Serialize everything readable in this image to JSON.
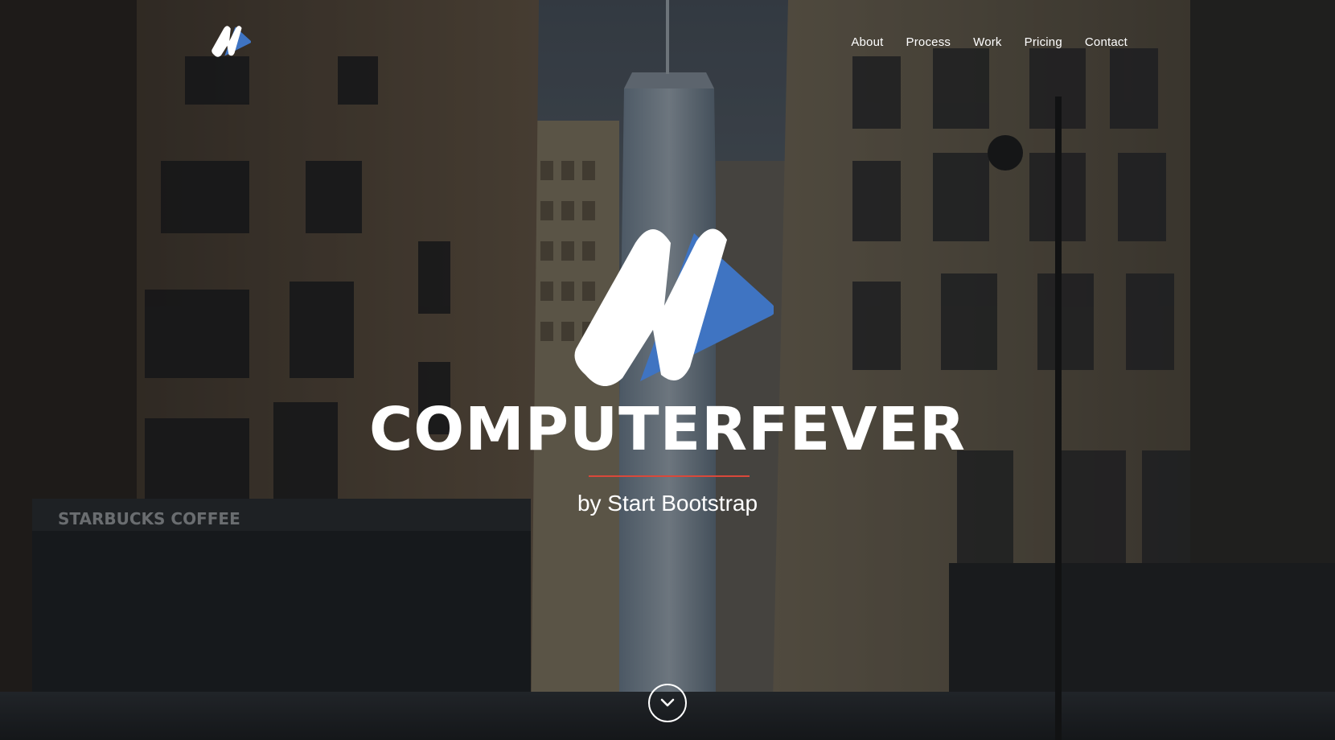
{
  "nav": {
    "logo_icon": "computerfever-m-logo-icon",
    "items": [
      {
        "label": "About"
      },
      {
        "label": "Process"
      },
      {
        "label": "Work"
      },
      {
        "label": "Pricing"
      },
      {
        "label": "Contact"
      }
    ]
  },
  "hero": {
    "logo_icon": "computerfever-m-logo-icon",
    "title": "COMPUTERFEVER",
    "subtitle": "by Start Bootstrap",
    "scroll_icon": "chevron-down-circle-icon",
    "background": "city-street-photo"
  },
  "colors": {
    "accent_blue": "#3f74c2",
    "divider_red": "#d9483a",
    "text": "#ffffff"
  }
}
